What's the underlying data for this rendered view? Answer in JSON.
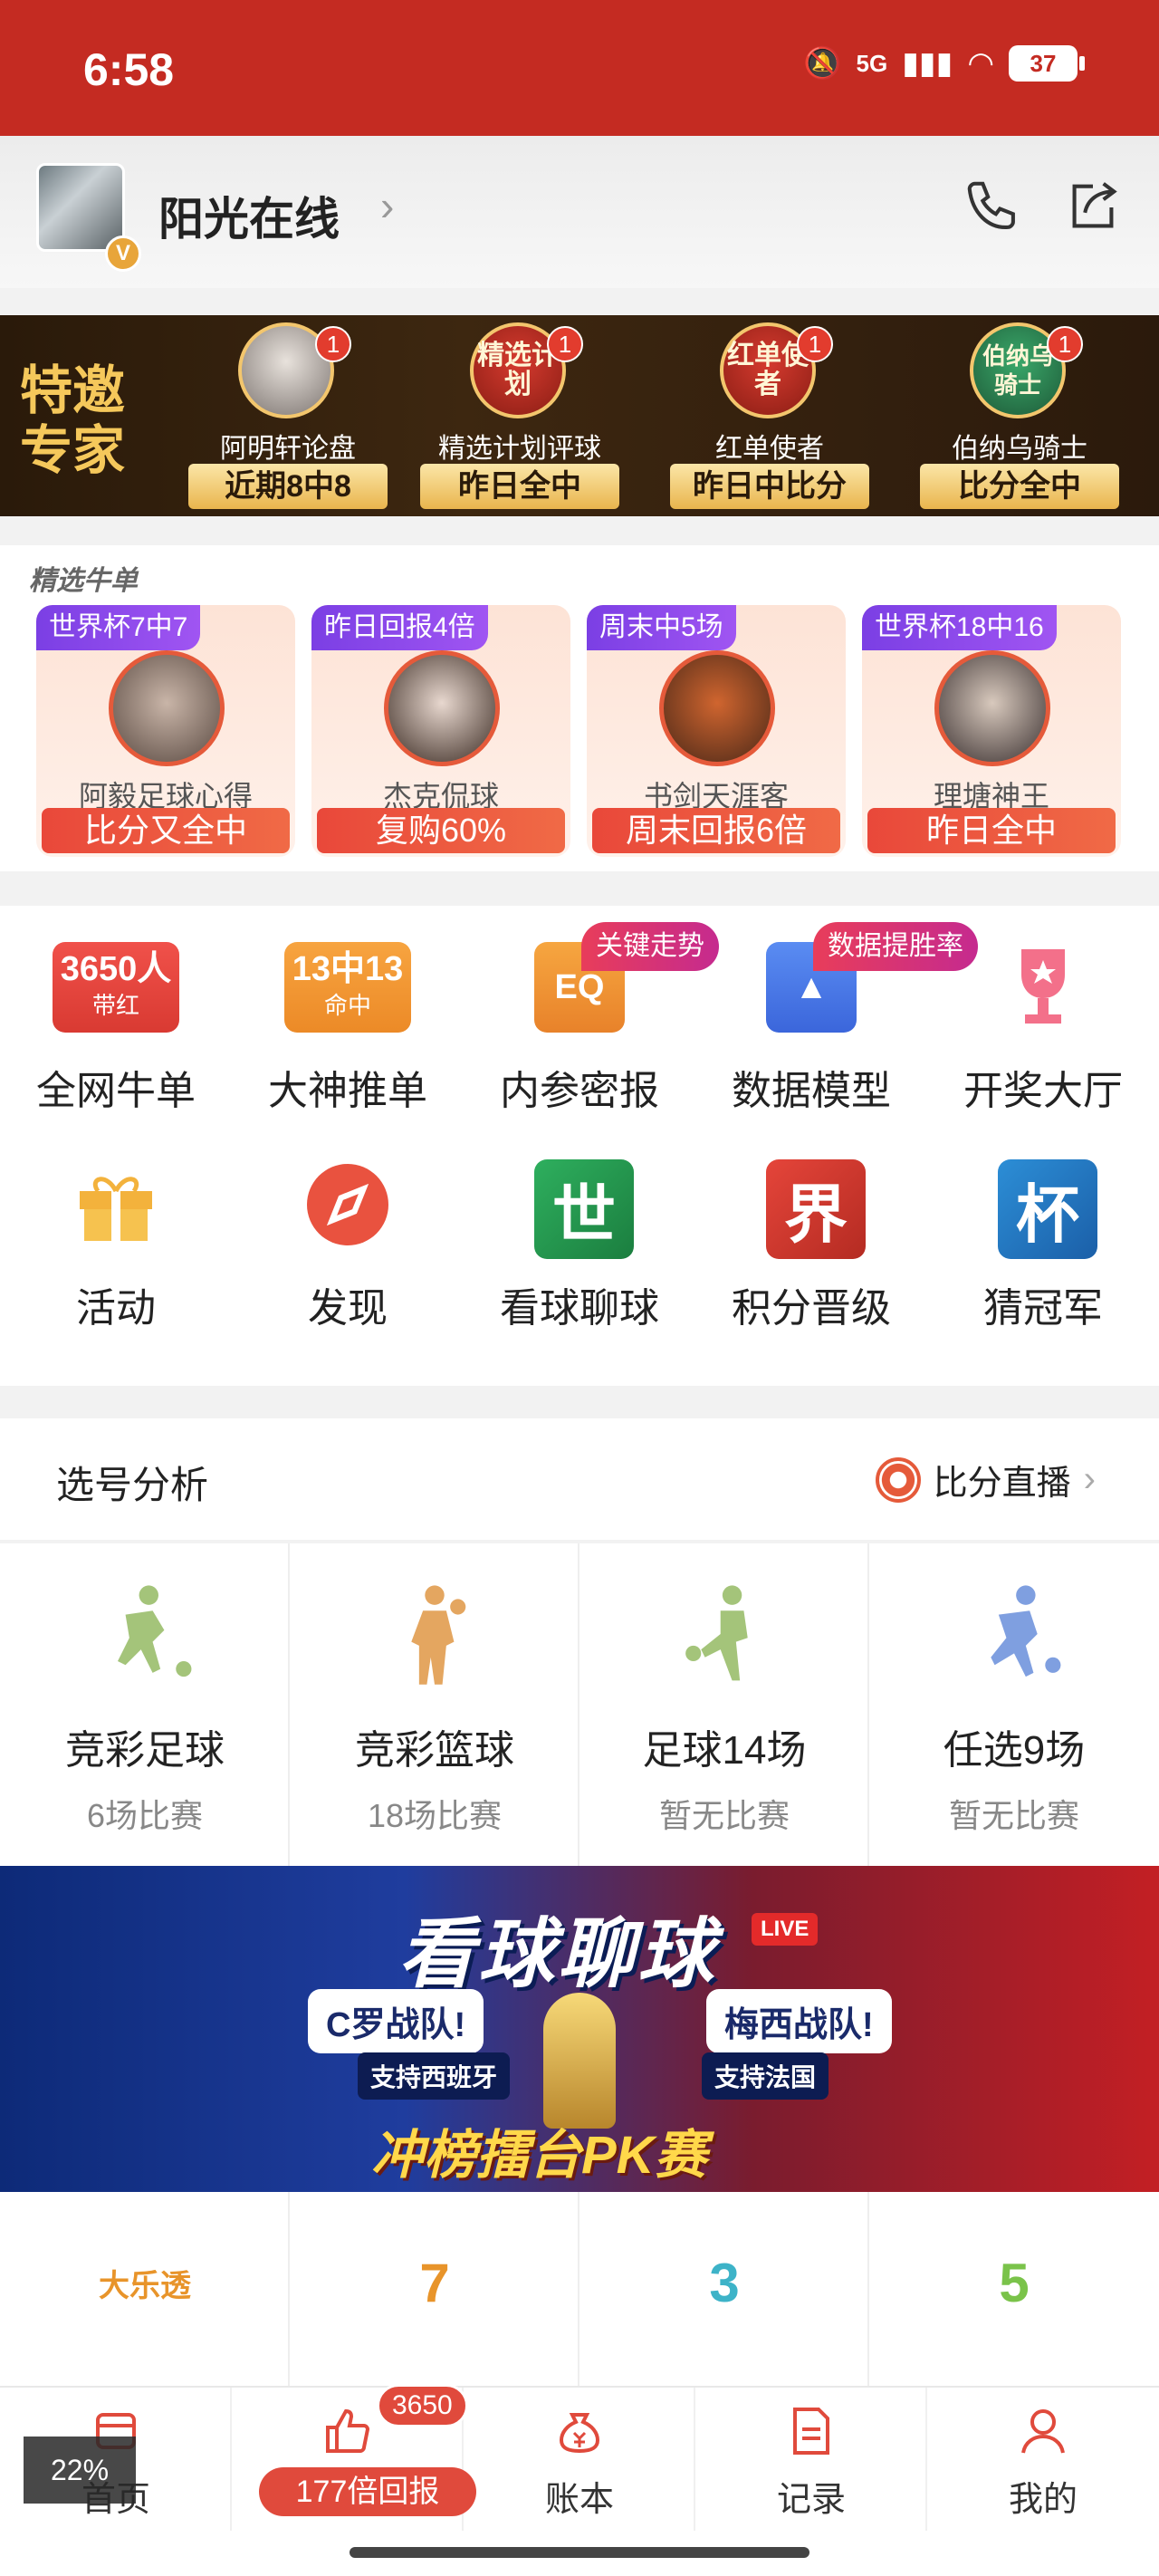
{
  "status": {
    "time": "6:58",
    "network": "5G",
    "battery": "37"
  },
  "header": {
    "name": "阳光在线",
    "verified_badge": "V"
  },
  "experts": {
    "tag": "特邀专家",
    "items": [
      {
        "name": "阿明轩论盘",
        "record": "近期8中8",
        "count": "1",
        "avatar_text": ""
      },
      {
        "name": "精选计划评球",
        "record": "昨日全中",
        "count": "1",
        "avatar_text": "精选计划"
      },
      {
        "name": "红单使者",
        "record": "昨日中比分",
        "count": "1",
        "avatar_text": "红单使者"
      },
      {
        "name": "伯纳乌骑士",
        "record": "比分全中",
        "count": "1",
        "avatar_text": "伯纳乌骑士"
      }
    ]
  },
  "featured": {
    "title": "精选牛单",
    "cards": [
      {
        "tag": "世界杯7中7",
        "name": "阿毅足球心得",
        "result": "比分又全中"
      },
      {
        "tag": "昨日回报4倍",
        "name": "杰克侃球",
        "result": "复购60%"
      },
      {
        "tag": "周末中5场",
        "name": "书剑天涯客",
        "result": "周末回报6倍"
      },
      {
        "tag": "世界杯18中16",
        "name": "理塘神王",
        "result": "昨日全中"
      }
    ]
  },
  "menu": {
    "row1": [
      {
        "label": "全网牛单",
        "icon": "3650人 带红",
        "icon_line1": "3650人",
        "icon_line2": "带红"
      },
      {
        "label": "大神推单",
        "icon_line1": "13中13",
        "icon_line2": "命中"
      },
      {
        "label": "内参密报",
        "pill": "关键走势"
      },
      {
        "label": "数据模型",
        "pill": "数据提胜率"
      },
      {
        "label": "开奖大厅"
      }
    ],
    "row2": [
      {
        "label": "活动"
      },
      {
        "label": "发现"
      },
      {
        "label": "看球聊球",
        "icon_text": "世"
      },
      {
        "label": "积分晋级",
        "icon_text": "界"
      },
      {
        "label": "猜冠军",
        "icon_text": "杯"
      }
    ]
  },
  "selection": {
    "title": "选号分析",
    "live_label": "比分直播"
  },
  "sports": [
    {
      "name": "竞彩足球",
      "count": "6场比赛"
    },
    {
      "name": "竞彩篮球",
      "count": "18场比赛"
    },
    {
      "name": "足球14场",
      "count": "暂无比赛"
    },
    {
      "name": "任选9场",
      "count": "暂无比赛"
    }
  ],
  "banner": {
    "title": "看球聊球",
    "live": "LIVE",
    "left_bubble": "C罗战队!",
    "left_sub": "支持西班牙",
    "right_bubble": "梅西战队!",
    "right_sub": "支持法国",
    "bottom": "冲榜擂台PK赛"
  },
  "lottery": [
    {
      "logo": "大乐透"
    },
    {
      "logo": "7"
    },
    {
      "logo": "3"
    },
    {
      "logo": "5"
    }
  ],
  "tabbar": {
    "items": [
      {
        "label": "首页"
      },
      {
        "label": "177倍回报",
        "badge": "3650"
      },
      {
        "label": "账本"
      },
      {
        "label": "记录"
      },
      {
        "label": "我的"
      }
    ],
    "zoom": "22%"
  },
  "colors": {
    "brand_red": "#c42b22",
    "accent_orange": "#e55a3a",
    "gold": "#f3c66d"
  }
}
